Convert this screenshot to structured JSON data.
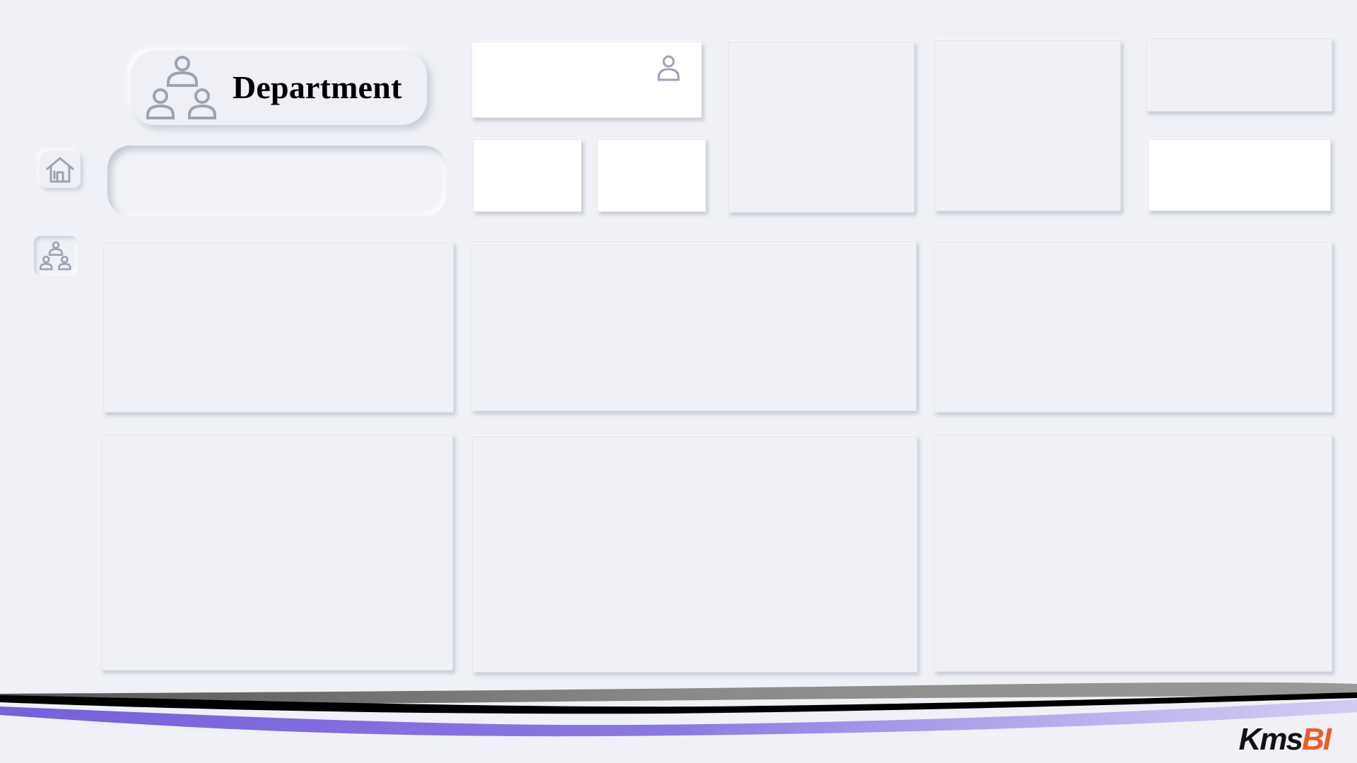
{
  "header": {
    "title": "Department",
    "title_icon": "org-chart-icon"
  },
  "nav": {
    "items": [
      {
        "id": "home",
        "icon": "home-icon",
        "active": false
      },
      {
        "id": "department",
        "icon": "org-chart-icon",
        "active": true
      }
    ]
  },
  "kpi_card": {
    "icon": "person-icon"
  },
  "brand": {
    "logo_main": "Kms",
    "logo_accent": "BI",
    "accent_color": "#ef5a24",
    "wave_colors": [
      "#000000",
      "#8a8a8a",
      "#6a4fd8"
    ]
  },
  "colors": {
    "background": "#eff1f6",
    "card_white": "#ffffff",
    "icon_stroke": "#9ea1b3"
  }
}
